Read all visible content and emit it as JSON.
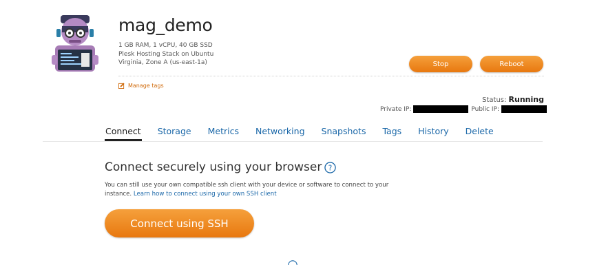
{
  "instance": {
    "name": "mag_demo",
    "specs": [
      "1 GB RAM, 1 vCPU, 40 GB SSD",
      "Plesk Hosting Stack on Ubuntu",
      "Virginia, Zone A (us-east-1a)"
    ],
    "manage_tags_label": "Manage tags"
  },
  "actions": {
    "stop_label": "Stop",
    "reboot_label": "Reboot"
  },
  "status": {
    "label": "Status:",
    "value": "Running",
    "private_ip_label": "Private IP:",
    "public_ip_label": "Public IP:"
  },
  "tabs": [
    {
      "label": "Connect",
      "active": true
    },
    {
      "label": "Storage"
    },
    {
      "label": "Metrics"
    },
    {
      "label": "Networking"
    },
    {
      "label": "Snapshots"
    },
    {
      "label": "Tags"
    },
    {
      "label": "History"
    },
    {
      "label": "Delete"
    }
  ],
  "connect": {
    "title": "Connect securely using your browser",
    "description": "You can still use your own compatible ssh client with your device or software to connect to your instance.",
    "link_text": "Learn how to connect using your own SSH client",
    "button_label": "Connect using SSH"
  },
  "colors": {
    "accent_orange": "#ec7a0f",
    "link_blue": "#1a67a8"
  }
}
